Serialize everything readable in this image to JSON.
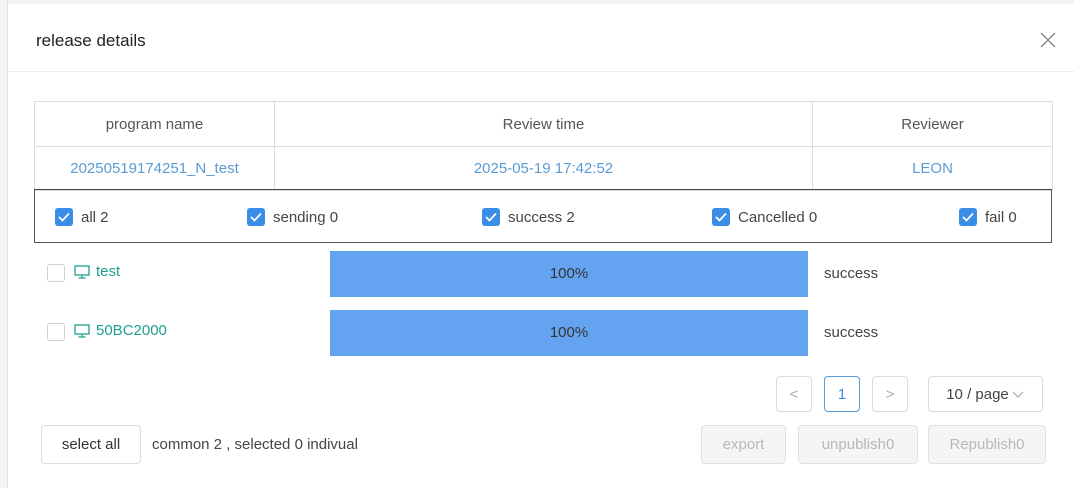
{
  "dialog": {
    "title": "release details"
  },
  "table": {
    "headers": [
      "program name",
      "Review time",
      "Reviewer"
    ],
    "row": [
      "20250519174251_N_test",
      "2025-05-19 17:42:52",
      "LEON"
    ]
  },
  "filters": [
    {
      "label": "all 2",
      "checked": true
    },
    {
      "label": "sending 0",
      "checked": true
    },
    {
      "label": "success 2",
      "checked": true
    },
    {
      "label": "Cancelled 0",
      "checked": true
    },
    {
      "label": "fail 0",
      "checked": true
    }
  ],
  "devices": [
    {
      "name": "test",
      "progress": 100,
      "progress_label": "100%",
      "status": "success",
      "icon": "monitor-icon"
    },
    {
      "name": "50BC2000",
      "progress": 100,
      "progress_label": "100%",
      "status": "success",
      "icon": "monitor-icon"
    }
  ],
  "pagination": {
    "prev": "<",
    "current": "1",
    "next": ">",
    "page_size": "10 / page"
  },
  "footer": {
    "select_all": "select all",
    "summary": "common 2 , selected 0 indivual",
    "export": "export",
    "unpublish": "unpublish0",
    "republish": "Republish0"
  },
  "colors": {
    "accent": "#3a8ee6",
    "progress": "#64a3f0",
    "link": "#5b9bd5",
    "device": "#20a08d"
  }
}
